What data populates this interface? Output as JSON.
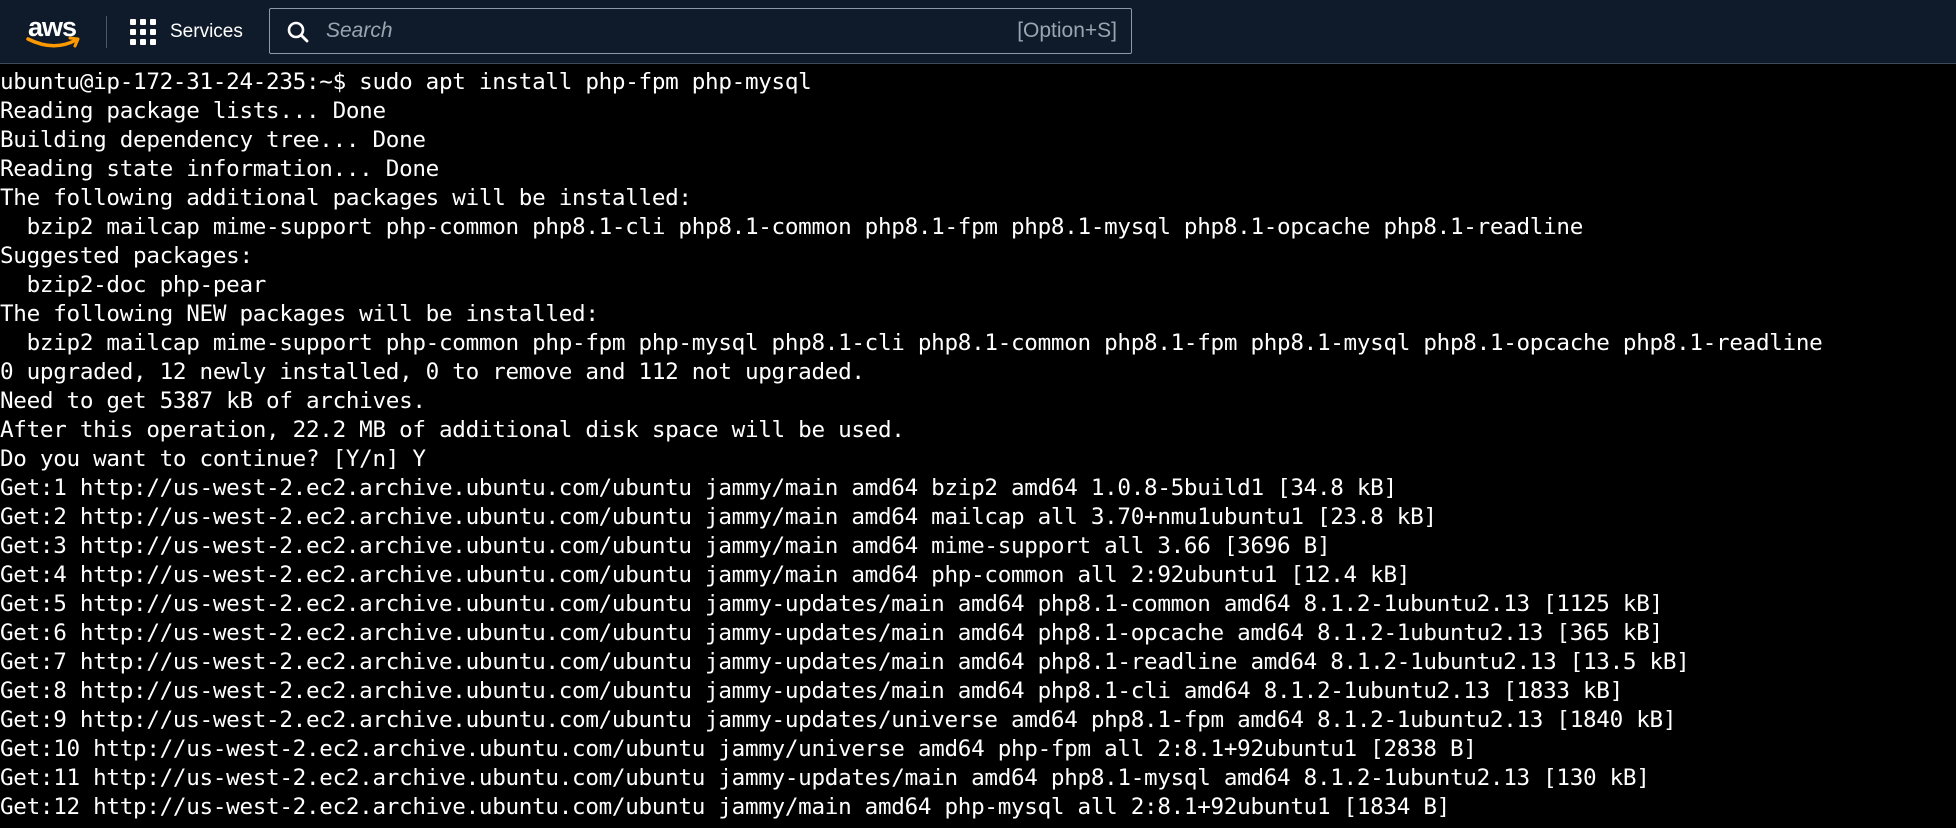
{
  "topbar": {
    "logo_text": "aws",
    "services_label": "Services",
    "search_placeholder": "Search",
    "search_shortcut": "[Option+S]",
    "colors": {
      "background": "#0f1b2a",
      "logo_smile": "#ff9900"
    },
    "icons": [
      "aws-logo",
      "grid-icon",
      "search-icon"
    ]
  },
  "terminal": {
    "prompt": "ubuntu@ip-172-31-24-235:~$",
    "command": "sudo apt install php-fpm php-mysql",
    "lines": [
      "ubuntu@ip-172-31-24-235:~$ sudo apt install php-fpm php-mysql",
      "Reading package lists... Done",
      "Building dependency tree... Done",
      "Reading state information... Done",
      "The following additional packages will be installed:",
      "  bzip2 mailcap mime-support php-common php8.1-cli php8.1-common php8.1-fpm php8.1-mysql php8.1-opcache php8.1-readline",
      "Suggested packages:",
      "  bzip2-doc php-pear",
      "The following NEW packages will be installed:",
      "  bzip2 mailcap mime-support php-common php-fpm php-mysql php8.1-cli php8.1-common php8.1-fpm php8.1-mysql php8.1-opcache php8.1-readline",
      "0 upgraded, 12 newly installed, 0 to remove and 112 not upgraded.",
      "Need to get 5387 kB of archives.",
      "After this operation, 22.2 MB of additional disk space will be used.",
      "Do you want to continue? [Y/n] Y",
      "Get:1 http://us-west-2.ec2.archive.ubuntu.com/ubuntu jammy/main amd64 bzip2 amd64 1.0.8-5build1 [34.8 kB]",
      "Get:2 http://us-west-2.ec2.archive.ubuntu.com/ubuntu jammy/main amd64 mailcap all 3.70+nmu1ubuntu1 [23.8 kB]",
      "Get:3 http://us-west-2.ec2.archive.ubuntu.com/ubuntu jammy/main amd64 mime-support all 3.66 [3696 B]",
      "Get:4 http://us-west-2.ec2.archive.ubuntu.com/ubuntu jammy/main amd64 php-common all 2:92ubuntu1 [12.4 kB]",
      "Get:5 http://us-west-2.ec2.archive.ubuntu.com/ubuntu jammy-updates/main amd64 php8.1-common amd64 8.1.2-1ubuntu2.13 [1125 kB]",
      "Get:6 http://us-west-2.ec2.archive.ubuntu.com/ubuntu jammy-updates/main amd64 php8.1-opcache amd64 8.1.2-1ubuntu2.13 [365 kB]",
      "Get:7 http://us-west-2.ec2.archive.ubuntu.com/ubuntu jammy-updates/main amd64 php8.1-readline amd64 8.1.2-1ubuntu2.13 [13.5 kB]",
      "Get:8 http://us-west-2.ec2.archive.ubuntu.com/ubuntu jammy-updates/main amd64 php8.1-cli amd64 8.1.2-1ubuntu2.13 [1833 kB]",
      "Get:9 http://us-west-2.ec2.archive.ubuntu.com/ubuntu jammy-updates/universe amd64 php8.1-fpm amd64 8.1.2-1ubuntu2.13 [1840 kB]",
      "Get:10 http://us-west-2.ec2.archive.ubuntu.com/ubuntu jammy/universe amd64 php-fpm all 2:8.1+92ubuntu1 [2838 B]",
      "Get:11 http://us-west-2.ec2.archive.ubuntu.com/ubuntu jammy-updates/main amd64 php8.1-mysql amd64 8.1.2-1ubuntu2.13 [130 kB]",
      "Get:12 http://us-west-2.ec2.archive.ubuntu.com/ubuntu jammy/main amd64 php-mysql all 2:8.1+92ubuntu1 [1834 B]"
    ]
  }
}
